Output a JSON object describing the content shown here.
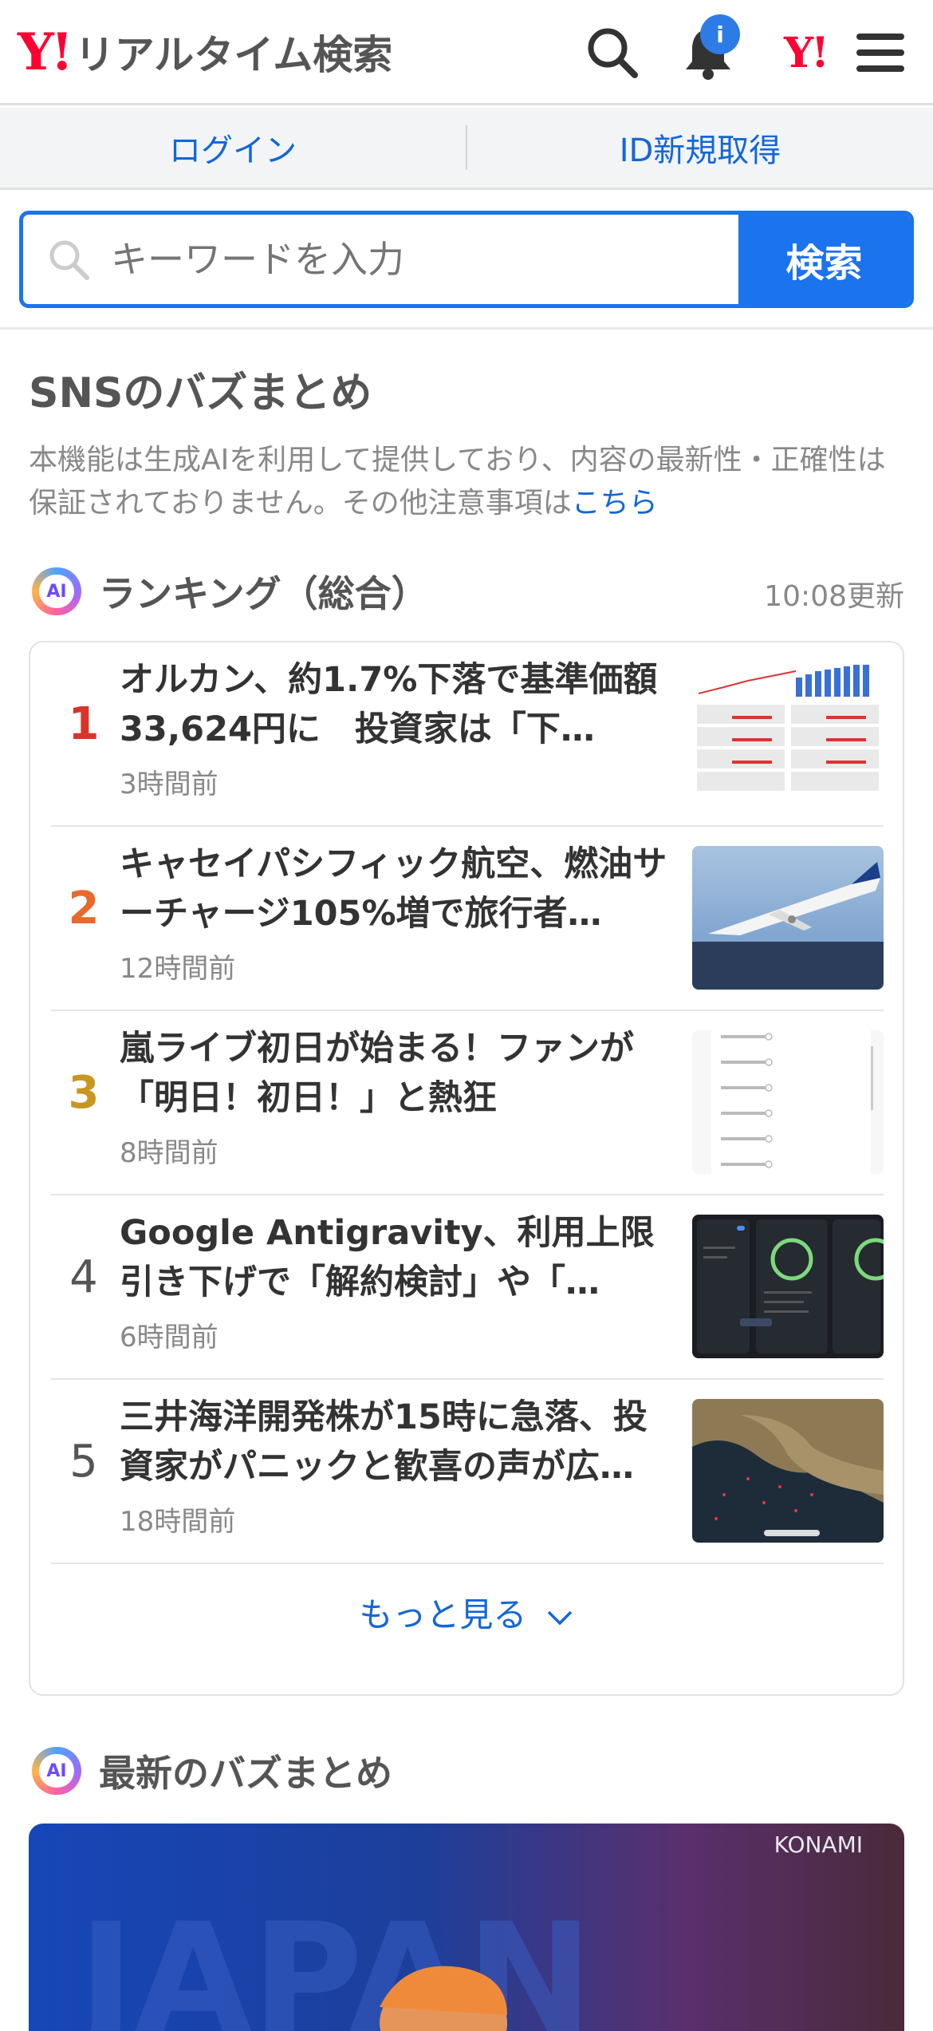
{
  "header": {
    "logo_mark": "Y!",
    "logo_text": "リアルタイム検索",
    "notification_badge": "i",
    "yahoo_mark": "Y!"
  },
  "auth": {
    "login": "ログイン",
    "signup": "ID新規取得"
  },
  "search": {
    "placeholder": "キーワードを入力",
    "button": "検索"
  },
  "sns": {
    "title": "SNSのバズまとめ",
    "notice": "本機能は生成AIを利用して提供しており、内容の最新性・正確性は保証されておりません。その他注意事項は",
    "notice_link": "こちら"
  },
  "ranking": {
    "ai_label": "AI",
    "title": "ランキング（総合）",
    "updated": "10:08更新",
    "items": [
      {
        "rank": "1",
        "title": "オルカン、約1.7%下落で基準価額33,624円に　投資家は「下…",
        "time": "3時間前",
        "color": "#d9342b"
      },
      {
        "rank": "2",
        "title": "キャセイパシフィック航空、燃油サーチャージ105%増で旅行者…",
        "time": "12時間前",
        "color": "#e8692c"
      },
      {
        "rank": "3",
        "title": "嵐ライブ初日が始まる！ファンが「明日！初日！」と熱狂",
        "time": "8時間前",
        "color": "#c9961f"
      },
      {
        "rank": "4",
        "title": "Google Antigravity、利用上限引き下げで「解約検討」や「…",
        "time": "6時間前",
        "color": "#555555"
      },
      {
        "rank": "5",
        "title": "三井海洋開発株が15時に急落、投資家がパニックと歓喜の声が広…",
        "time": "18時間前",
        "color": "#555555"
      }
    ],
    "more": "もっと見る"
  },
  "latest": {
    "ai_label": "AI",
    "title": "最新のバズまとめ",
    "image_caption": "KONAMI"
  }
}
